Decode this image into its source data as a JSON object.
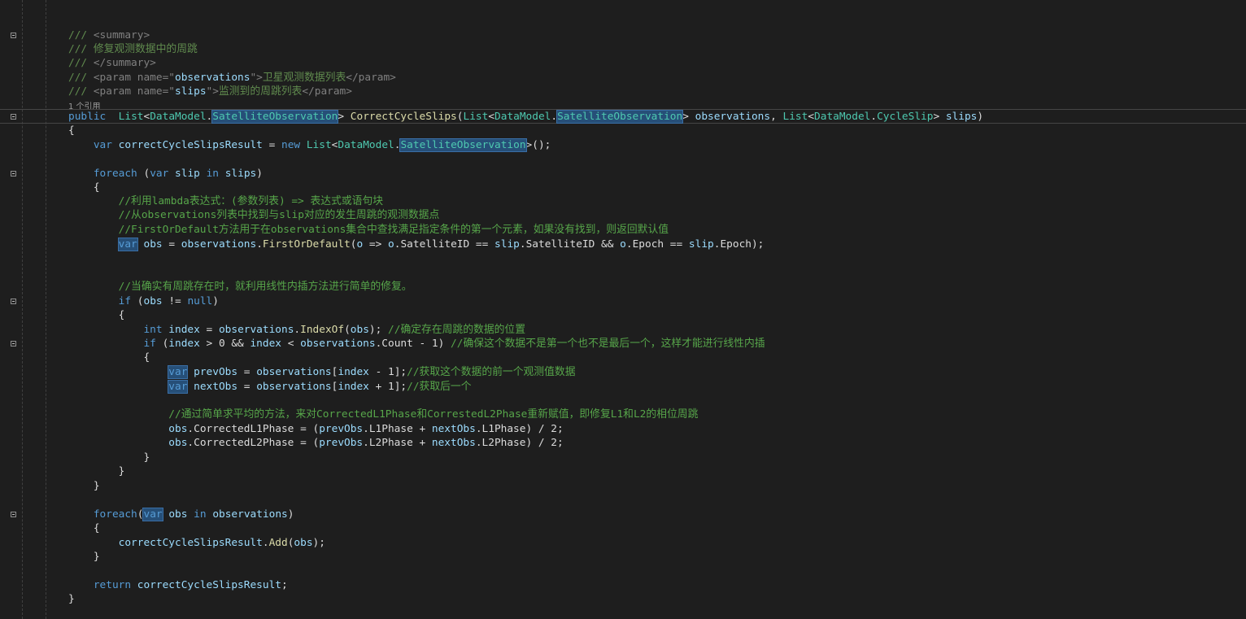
{
  "codelens": "1 个引用",
  "lines": [
    {
      "segs": [
        [
          "doc",
          "/// "
        ],
        [
          "dt",
          "<summary>"
        ]
      ]
    },
    {
      "segs": [
        [
          "doc",
          "/// 修复观测数据中的周跳"
        ]
      ]
    },
    {
      "segs": [
        [
          "doc",
          "/// "
        ],
        [
          "dt",
          "</summary>"
        ]
      ]
    },
    {
      "segs": [
        [
          "doc",
          "/// "
        ],
        [
          "dt",
          "<param name=\""
        ],
        [
          "pr",
          "observations"
        ],
        [
          "dt",
          "\">"
        ],
        [
          "doc",
          "卫星观测数据列表"
        ],
        [
          "dt",
          "</param>"
        ]
      ]
    },
    {
      "segs": [
        [
          "doc",
          "/// "
        ],
        [
          "dt",
          "<param name=\""
        ],
        [
          "pr",
          "slips"
        ],
        [
          "dt",
          "\">"
        ],
        [
          "doc",
          "监测到的周跳列表"
        ],
        [
          "dt",
          "</param>"
        ]
      ]
    },
    {
      "segs": [
        [
          "kw",
          "public"
        ],
        [
          "",
          "  "
        ],
        [
          "ty",
          "List"
        ],
        [
          "",
          "<"
        ],
        [
          "ty",
          "DataModel"
        ],
        [
          "",
          "."
        ],
        [
          "tyhl",
          "SatelliteObservation"
        ],
        [
          "",
          "> "
        ],
        [
          "mt",
          "CorrectCycleSlips"
        ],
        [
          "",
          "("
        ],
        [
          "ty",
          "List"
        ],
        [
          "",
          "<"
        ],
        [
          "ty",
          "DataModel"
        ],
        [
          "",
          "."
        ],
        [
          "tyhl",
          "SatelliteObservation"
        ],
        [
          "",
          "> "
        ],
        [
          "pr",
          "observations"
        ],
        [
          "",
          ", "
        ],
        [
          "ty",
          "List"
        ],
        [
          "",
          "<"
        ],
        [
          "ty",
          "DataModel"
        ],
        [
          "",
          "."
        ],
        [
          "ty",
          "CycleSlip"
        ],
        [
          "",
          "> "
        ],
        [
          "pr",
          "slips"
        ],
        [
          "",
          ")"
        ]
      ]
    },
    {
      "segs": [
        [
          "",
          "{"
        ]
      ]
    },
    {
      "segs": [
        [
          "",
          "    "
        ],
        [
          "kw",
          "var"
        ],
        [
          "",
          " "
        ],
        [
          "pr",
          "correctCycleSlipsResult"
        ],
        [
          "",
          " = "
        ],
        [
          "kw",
          "new"
        ],
        [
          "",
          " "
        ],
        [
          "ty",
          "List"
        ],
        [
          "",
          "<"
        ],
        [
          "ty",
          "DataModel"
        ],
        [
          "",
          "."
        ],
        [
          "tyhl",
          "SatelliteObservation"
        ],
        [
          "",
          ">();"
        ]
      ]
    },
    {
      "segs": [
        [
          "",
          "    "
        ],
        [
          "kw",
          "foreach"
        ],
        [
          "",
          " ("
        ],
        [
          "kw",
          "var"
        ],
        [
          "",
          " "
        ],
        [
          "pr",
          "slip"
        ],
        [
          "",
          " "
        ],
        [
          "kw",
          "in"
        ],
        [
          "",
          " "
        ],
        [
          "pr",
          "slips"
        ],
        [
          "",
          ")"
        ]
      ]
    },
    {
      "segs": [
        [
          "",
          "    {"
        ]
      ]
    },
    {
      "segs": [
        [
          "",
          "        "
        ],
        [
          "cm",
          "//利用lambda表达式：(参数列表) => 表达式或语句块"
        ]
      ]
    },
    {
      "segs": [
        [
          "",
          "        "
        ],
        [
          "cm",
          "//从observations列表中找到与slip对应的发生周跳的观测数据点"
        ]
      ]
    },
    {
      "segs": [
        [
          "",
          "        "
        ],
        [
          "cm",
          "//FirstOrDefault方法用于在observations集合中查找满足指定条件的第一个元素，如果没有找到，则返回默认值"
        ]
      ]
    },
    {
      "segs": [
        [
          "",
          "        "
        ],
        [
          "kwhl",
          "var"
        ],
        [
          "",
          " "
        ],
        [
          "pr",
          "obs"
        ],
        [
          "",
          " = "
        ],
        [
          "pr",
          "observations"
        ],
        [
          "",
          "."
        ],
        [
          "mt",
          "FirstOrDefault"
        ],
        [
          "",
          "("
        ],
        [
          "pr",
          "o"
        ],
        [
          "",
          " => "
        ],
        [
          "pr",
          "o"
        ],
        [
          "",
          ".SatelliteID == "
        ],
        [
          "pr",
          "slip"
        ],
        [
          "",
          ".SatelliteID && "
        ],
        [
          "pr",
          "o"
        ],
        [
          "",
          ".Epoch == "
        ],
        [
          "pr",
          "slip"
        ],
        [
          "",
          ".Epoch);"
        ]
      ]
    },
    {
      "segs": [
        [
          "",
          "        "
        ],
        [
          "cm",
          "//当确实有周跳存在时，就利用线性内插方法进行简单的修复。"
        ]
      ]
    },
    {
      "segs": [
        [
          "",
          "        "
        ],
        [
          "kw",
          "if"
        ],
        [
          "",
          " ("
        ],
        [
          "pr",
          "obs"
        ],
        [
          "",
          " != "
        ],
        [
          "kw",
          "null"
        ],
        [
          "",
          ")"
        ]
      ]
    },
    {
      "segs": [
        [
          "",
          "        {"
        ]
      ]
    },
    {
      "segs": [
        [
          "",
          "            "
        ],
        [
          "kw",
          "int"
        ],
        [
          "",
          " "
        ],
        [
          "pr",
          "index"
        ],
        [
          "",
          " = "
        ],
        [
          "pr",
          "observations"
        ],
        [
          "",
          "."
        ],
        [
          "mt",
          "IndexOf"
        ],
        [
          "",
          "("
        ],
        [
          "pr",
          "obs"
        ],
        [
          "",
          "); "
        ],
        [
          "cm",
          "//确定存在周跳的数据的位置"
        ]
      ]
    },
    {
      "segs": [
        [
          "",
          "            "
        ],
        [
          "kw",
          "if"
        ],
        [
          "",
          " ("
        ],
        [
          "pr",
          "index"
        ],
        [
          "",
          " > 0 && "
        ],
        [
          "pr",
          "index"
        ],
        [
          "",
          " < "
        ],
        [
          "pr",
          "observations"
        ],
        [
          "",
          ".Count - 1) "
        ],
        [
          "cm",
          "//确保这个数据不是第一个也不是最后一个，这样才能进行线性内插"
        ]
      ]
    },
    {
      "segs": [
        [
          "",
          "            {"
        ]
      ]
    },
    {
      "segs": [
        [
          "",
          "                "
        ],
        [
          "kwhl",
          "var"
        ],
        [
          "",
          " "
        ],
        [
          "pr",
          "prevObs"
        ],
        [
          "",
          " = "
        ],
        [
          "pr",
          "observations"
        ],
        [
          "",
          "["
        ],
        [
          "pr",
          "index"
        ],
        [
          "",
          " - 1];"
        ],
        [
          "cm",
          "//获取这个数据的前一个观测值数据"
        ]
      ]
    },
    {
      "segs": [
        [
          "",
          "                "
        ],
        [
          "kwhl",
          "var"
        ],
        [
          "",
          " "
        ],
        [
          "pr",
          "nextObs"
        ],
        [
          "",
          " = "
        ],
        [
          "pr",
          "observations"
        ],
        [
          "",
          "["
        ],
        [
          "pr",
          "index"
        ],
        [
          "",
          " + 1];"
        ],
        [
          "cm",
          "//获取后一个"
        ]
      ]
    },
    {
      "segs": [
        [
          "",
          "                "
        ],
        [
          "cm",
          "//通过简单求平均的方法，来对CorrectedL1Phase和CorrestedL2Phase重新赋值，即修复L1和L2的相位周跳"
        ]
      ]
    },
    {
      "segs": [
        [
          "",
          "                "
        ],
        [
          "pr",
          "obs"
        ],
        [
          "",
          ".CorrectedL1Phase = ("
        ],
        [
          "pr",
          "prevObs"
        ],
        [
          "",
          ".L1Phase + "
        ],
        [
          "pr",
          "nextObs"
        ],
        [
          "",
          ".L1Phase) / 2;"
        ]
      ]
    },
    {
      "segs": [
        [
          "",
          "                "
        ],
        [
          "pr",
          "obs"
        ],
        [
          "",
          ".CorrectedL2Phase = ("
        ],
        [
          "pr",
          "prevObs"
        ],
        [
          "",
          ".L2Phase + "
        ],
        [
          "pr",
          "nextObs"
        ],
        [
          "",
          ".L2Phase) / 2;"
        ]
      ]
    },
    {
      "segs": [
        [
          "",
          "            }"
        ]
      ]
    },
    {
      "segs": [
        [
          "",
          "        }"
        ]
      ]
    },
    {
      "segs": [
        [
          "",
          "    }"
        ]
      ]
    },
    {
      "segs": [
        [
          "",
          "    "
        ],
        [
          "kw",
          "foreach"
        ],
        [
          "",
          "("
        ],
        [
          "kwhl",
          "var"
        ],
        [
          "",
          " "
        ],
        [
          "pr",
          "obs"
        ],
        [
          "",
          " "
        ],
        [
          "kw",
          "in"
        ],
        [
          "",
          " "
        ],
        [
          "pr",
          "observations"
        ],
        [
          "",
          ")"
        ]
      ]
    },
    {
      "segs": [
        [
          "",
          "    {"
        ]
      ]
    },
    {
      "segs": [
        [
          "",
          "        "
        ],
        [
          "pr",
          "correctCycleSlipsResult"
        ],
        [
          "",
          "."
        ],
        [
          "mt",
          "Add"
        ],
        [
          "",
          "("
        ],
        [
          "pr",
          "obs"
        ],
        [
          "",
          ");"
        ]
      ]
    },
    {
      "segs": [
        [
          "",
          "    }"
        ]
      ]
    },
    {
      "segs": [
        [
          "",
          "    "
        ],
        [
          "kw",
          "return"
        ],
        [
          "",
          " "
        ],
        [
          "pr",
          "correctCycleSlipsResult"
        ],
        [
          "",
          ";"
        ]
      ]
    },
    {
      "segs": [
        [
          "",
          "}"
        ]
      ]
    }
  ]
}
